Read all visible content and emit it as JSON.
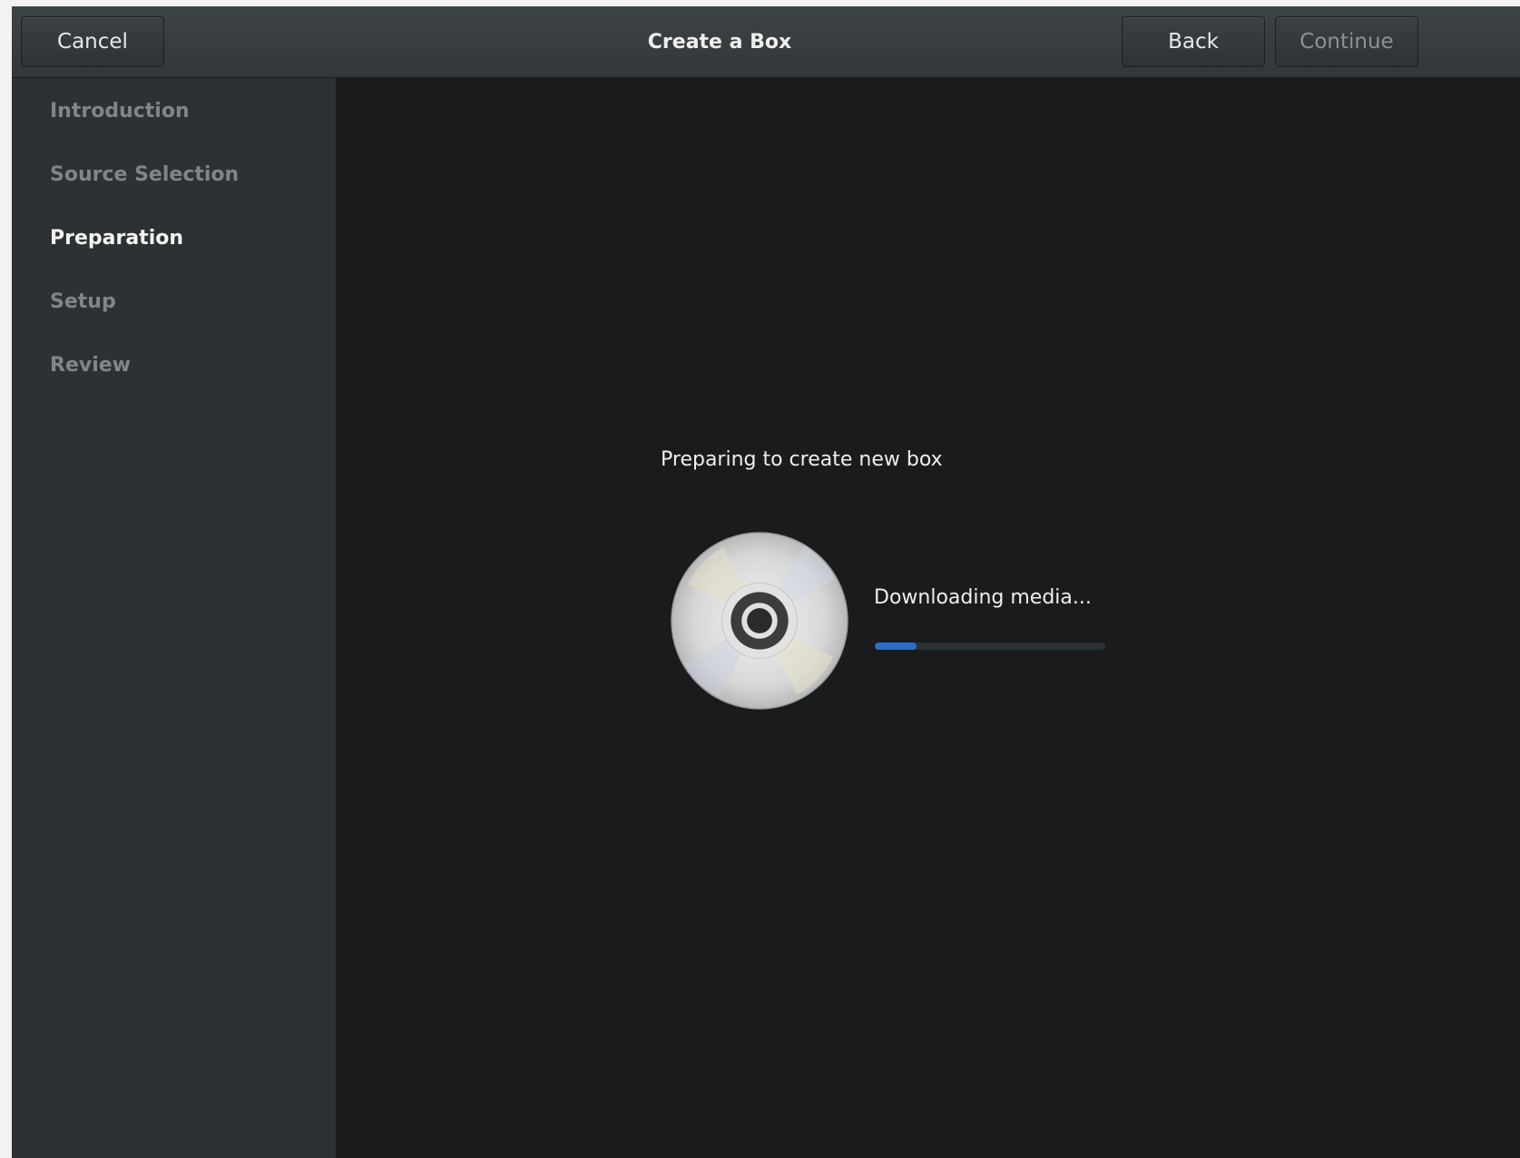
{
  "header": {
    "title": "Create a Box",
    "cancel_label": "Cancel",
    "back_label": "Back",
    "continue_label": "Continue"
  },
  "sidebar": {
    "items": [
      {
        "label": "Introduction",
        "active": false
      },
      {
        "label": "Source Selection",
        "active": false
      },
      {
        "label": "Preparation",
        "active": true
      },
      {
        "label": "Setup",
        "active": false
      },
      {
        "label": "Review",
        "active": false
      }
    ]
  },
  "main": {
    "heading": "Preparing to create new box",
    "media_icon": "optical-disc-icon",
    "status_text": "Downloading media...",
    "progress_fraction": 0.18
  },
  "colors": {
    "progress_accent": "#2a6fc5",
    "window_bg": "#1a1b1c",
    "sidebar_bg": "#2c3133"
  }
}
